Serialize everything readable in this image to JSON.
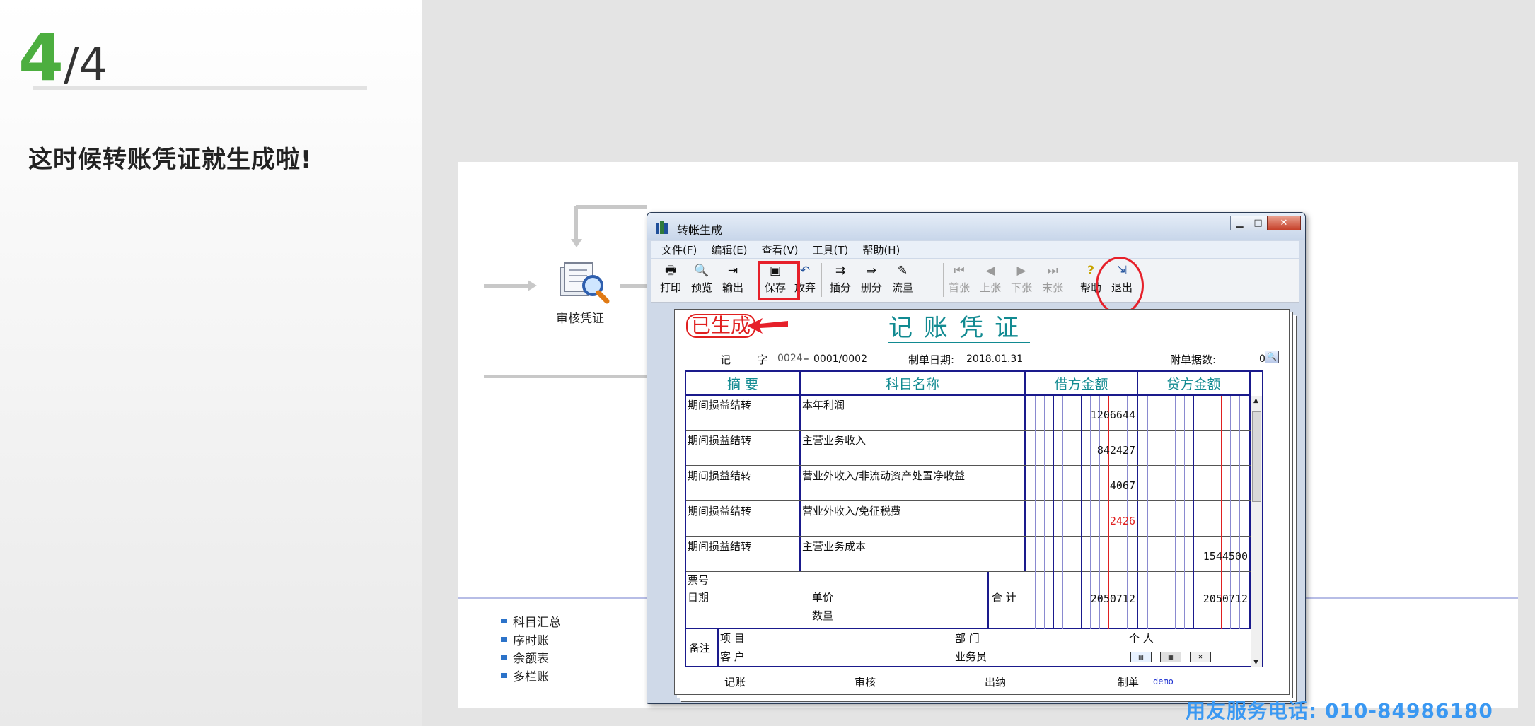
{
  "slide": {
    "step_current": "4",
    "step_total": "/4",
    "headline": "这时候转账凭证就生成啦!"
  },
  "flow": {
    "audit_label": "审核凭证",
    "bullets": [
      "科目汇总",
      "序时账",
      "余额表",
      "多栏账"
    ]
  },
  "window": {
    "title": "转帐生成",
    "menu": [
      "文件(F)",
      "编辑(E)",
      "查看(V)",
      "工具(T)",
      "帮助(H)"
    ],
    "toolbar": {
      "print": "打印",
      "preview": "预览",
      "output": "输出",
      "save": "保存",
      "discard": "放弃",
      "insert_split": "插分",
      "delete_split": "删分",
      "cashflow": "流量",
      "first": "首张",
      "prev": "上张",
      "next": "下张",
      "last": "末张",
      "help": "帮助",
      "exit": "退出"
    }
  },
  "voucher": {
    "stamp": "已生成",
    "title": "记账凭证",
    "type_label": "记",
    "zi_label": "字",
    "type_no": "0024",
    "page_no": "0001/0002",
    "date_label": "制单日期:",
    "date": "2018.01.31",
    "attach_label": "附单据数:",
    "attach_count": "0",
    "headers": {
      "summary": "摘 要",
      "account": "科目名称",
      "debit": "借方金额",
      "credit": "贷方金额"
    },
    "rows": [
      {
        "summary": "期间损益结转",
        "account": "本年利润",
        "debit": "1206644",
        "credit": "",
        "debit_red": false
      },
      {
        "summary": "期间损益结转",
        "account": "主营业务收入",
        "debit": "842427",
        "credit": "",
        "debit_red": false
      },
      {
        "summary": "期间损益结转",
        "account": "营业外收入/非流动资产处置净收益",
        "debit": "4067",
        "credit": "",
        "debit_red": false
      },
      {
        "summary": "期间损益结转",
        "account": "营业外收入/免征税费",
        "debit": "2426",
        "credit": "",
        "debit_red": true
      },
      {
        "summary": "期间损益结转",
        "account": "主营业务成本",
        "debit": "",
        "credit": "1544500",
        "debit_red": false
      }
    ],
    "footer": {
      "ticket_no": "票号",
      "date": "日期",
      "unit_price": "单价",
      "quantity": "数量",
      "total_label": "合 计",
      "total_debit": "2050712",
      "total_credit": "2050712",
      "remark": "备注",
      "project": "项  目",
      "customer": "客  户",
      "dept": "部  门",
      "salesman": "业务员",
      "person": "个  人"
    },
    "signatures": {
      "posting": "记账",
      "review": "审核",
      "cashier": "出纳",
      "maker": "制单",
      "maker_name": "demo"
    }
  },
  "hotline": "用友服务电话: 010-84986180",
  "colors": {
    "accent_green": "#4cae3f",
    "voucher_teal": "#118a91",
    "grid_blue": "#1a1a8c",
    "highlight_red": "#e6202a",
    "hotline_blue": "#3a98f2"
  }
}
